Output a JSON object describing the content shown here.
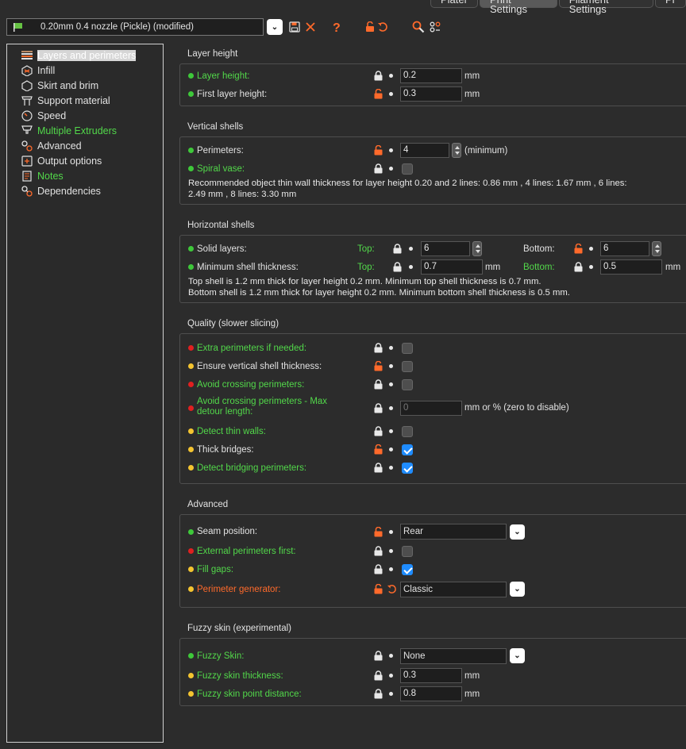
{
  "tabs": [
    "Plater",
    "Print Settings",
    "Filament Settings",
    "Pr"
  ],
  "preset": "0.20mm 0.4 nozzle (Pickle) (modified)",
  "sidebar": [
    {
      "label": "Layers and perimeters",
      "color": "#e2e2e2"
    },
    {
      "label": "Infill",
      "color": "#e2e2e2"
    },
    {
      "label": "Skirt and brim",
      "color": "#e2e2e2"
    },
    {
      "label": "Support material",
      "color": "#e2e2e2"
    },
    {
      "label": "Speed",
      "color": "#e2e2e2"
    },
    {
      "label": "Multiple Extruders",
      "color": "#52d84a"
    },
    {
      "label": "Advanced",
      "color": "#e2e2e2"
    },
    {
      "label": "Output options",
      "color": "#e2e2e2"
    },
    {
      "label": "Notes",
      "color": "#52d84a"
    },
    {
      "label": "Dependencies",
      "color": "#e2e2e2"
    }
  ],
  "layer_height": {
    "title": "Layer height",
    "layer_height_label": "Layer height:",
    "layer_height_value": "0.2",
    "first_label": "First layer height:",
    "first_value": "0.3",
    "unit": "mm"
  },
  "vertical": {
    "title": "Vertical shells",
    "perimeters_label": "Perimeters:",
    "perimeters_value": "4",
    "perimeters_unit": "(minimum)",
    "spiral_label": "Spiral vase:",
    "note1": "Recommended object thin wall thickness for layer height 0.20 and 2 lines: 0.86 mm , 4 lines: 1.67 mm , 6 lines:",
    "note2": "2.49 mm , 8 lines: 3.30 mm"
  },
  "horizontal": {
    "title": "Horizontal shells",
    "solid_label": "Solid layers:",
    "top_label": "Top:",
    "top_value": "6",
    "bottom_label": "Bottom:",
    "bottom_value": "6",
    "minshell_label": "Minimum shell thickness:",
    "min_top_value": "0.7",
    "min_bottom_value": "0.5",
    "unit": "mm",
    "note1": "Top shell is 1.2 mm thick for layer height 0.2 mm. Minimum top shell thickness is 0.7 mm.",
    "note2": "Bottom shell is 1.2 mm thick for layer height 0.2 mm. Minimum bottom shell thickness is 0.5 mm."
  },
  "quality": {
    "title": "Quality (slower slicing)",
    "extra": "Extra perimeters if needed:",
    "ensure": "Ensure vertical shell thickness:",
    "avoid": "Avoid crossing perimeters:",
    "avoid_max1": "Avoid crossing perimeters - Max",
    "avoid_max2": "detour length:",
    "avoid_max_value": "0",
    "avoid_max_unit": "mm or % (zero to disable)",
    "thin": "Detect thin walls:",
    "thick": "Thick bridges:",
    "bridging": "Detect bridging perimeters:"
  },
  "advanced": {
    "title": "Advanced",
    "seam_label": "Seam position:",
    "seam_value": "Rear",
    "external": "External perimeters first:",
    "fill_gaps": "Fill gaps:",
    "generator_label": "Perimeter generator:",
    "generator_value": "Classic"
  },
  "fuzzy": {
    "title": "Fuzzy skin (experimental)",
    "fuzzy_label": "Fuzzy Skin:",
    "fuzzy_value": "None",
    "thickness_label": "Fuzzy skin thickness:",
    "thickness_value": "0.3",
    "distance_label": "Fuzzy skin point distance:",
    "distance_value": "0.8",
    "unit": "mm"
  },
  "colors": {
    "accent": "#ff6a2b",
    "green": "#52d84a",
    "check": "#1f8cff"
  }
}
